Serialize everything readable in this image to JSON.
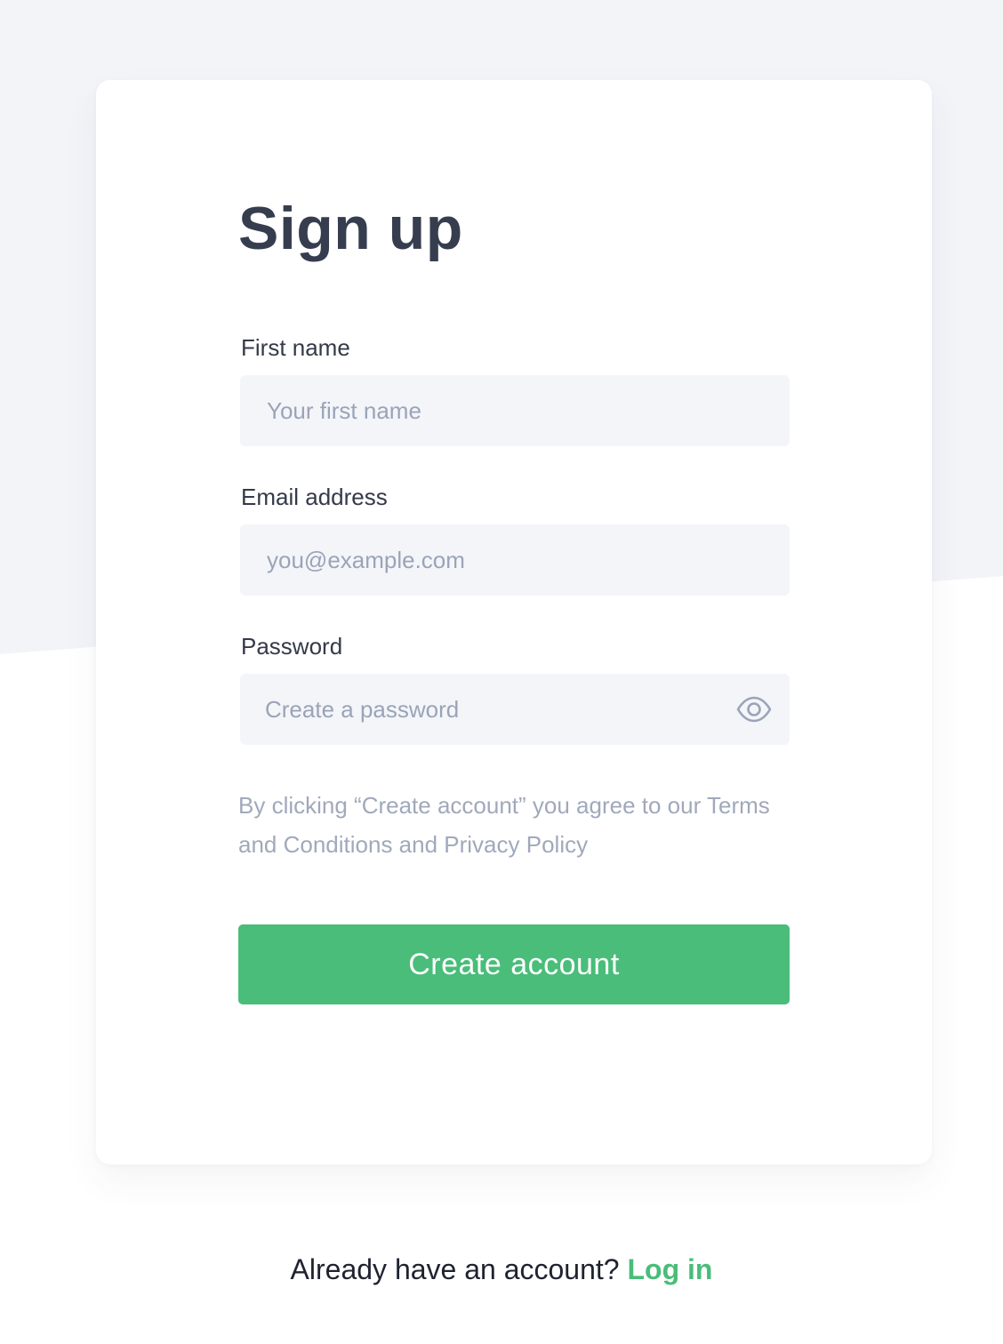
{
  "colors": {
    "background_top": "#f3f4f8",
    "background_bottom": "#ffffff",
    "card": "#ffffff",
    "accent": "#49bd79",
    "field_bg": "#f4f5f9",
    "placeholder": "#9aa4b8",
    "title": "#363d4f"
  },
  "form": {
    "title": "Sign up",
    "first_name": {
      "label": "First name",
      "placeholder": "Your first name",
      "value": ""
    },
    "email": {
      "label": "Email address",
      "placeholder": "you@example.com",
      "value": ""
    },
    "password": {
      "label": "Password",
      "placeholder": "Create a password",
      "value": "",
      "toggle_icon": "eye-icon"
    },
    "terms_text": "By clicking “Create account” you agree to our Terms and Conditions and Privacy Policy",
    "submit_label": "Create account"
  },
  "footer": {
    "prompt": "Already have an account?",
    "login_label": "Log in"
  }
}
